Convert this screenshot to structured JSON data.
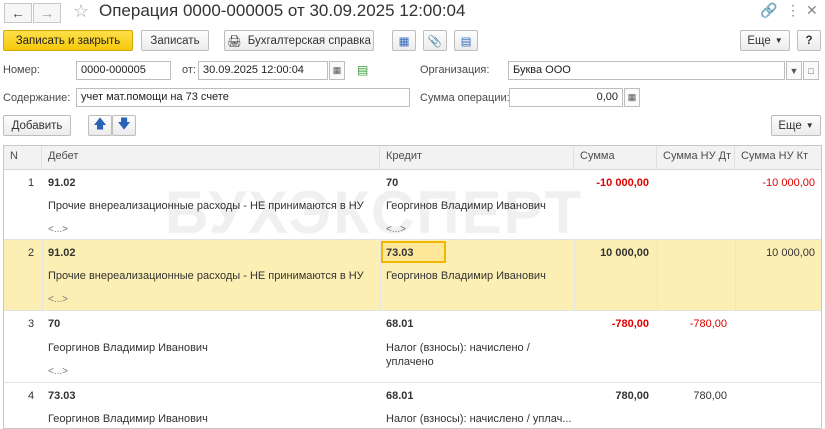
{
  "window": {
    "title": "Операция 0000-000005 от 30.09.2025 12:00:04"
  },
  "toolbar": {
    "save_close": "Записать и закрыть",
    "save": "Записать",
    "accounting_report": "Бухгалтерская справка",
    "more": "Еще"
  },
  "form": {
    "number_label": "Номер:",
    "number_value": "0000-000005",
    "date_label": "от:",
    "date_value": "30.09.2025 12:00:04",
    "org_label": "Организация:",
    "org_value": "Буква ООО",
    "content_label": "Содержание:",
    "content_value": "учет мат.помощи на 73 счете",
    "sum_label": "Сумма операции:",
    "sum_value": "0,00"
  },
  "table_toolbar": {
    "add": "Добавить",
    "more": "Еще"
  },
  "table": {
    "headers": {
      "n": "N",
      "debit": "Дебет",
      "credit": "Кредит",
      "sum": "Сумма",
      "sum_nu_dt": "Сумма НУ Дт",
      "sum_nu_kt": "Сумма НУ Кт"
    },
    "rows": [
      {
        "n": "1",
        "debit_account": "91.02",
        "debit_sub1": "Прочие внереализационные расходы - НЕ принимаются в НУ",
        "debit_sub2": "<...>",
        "credit_account": "70",
        "credit_sub1": "Георгинов Владимир Иванович",
        "credit_sub2": "<...>",
        "sum": "-10 000,00",
        "sum_nu_dt": "",
        "sum_nu_kt": "-10 000,00"
      },
      {
        "n": "2",
        "debit_account": "91.02",
        "debit_sub1": "Прочие внереализационные расходы - НЕ принимаются в НУ",
        "debit_sub2": "<...>",
        "credit_account": "73.03",
        "credit_sub1": "Георгинов Владимир Иванович",
        "credit_sub2": "",
        "sum": "10 000,00",
        "sum_nu_dt": "",
        "sum_nu_kt": "10 000,00"
      },
      {
        "n": "3",
        "debit_account": "70",
        "debit_sub1": "Георгинов Владимир Иванович",
        "debit_sub2": "<...>",
        "credit_account": "68.01",
        "credit_sub1": "Налог (взносы): начислено /",
        "credit_sub1b": "уплачено",
        "sum": "-780,00",
        "sum_nu_dt": "-780,00",
        "sum_nu_kt": ""
      },
      {
        "n": "4",
        "debit_account": "73.03",
        "debit_sub1": "Георгинов Владимир Иванович",
        "credit_account": "68.01",
        "credit_sub1": "Налог (взносы): начислено / уплач...",
        "sum": "780,00",
        "sum_nu_dt": "780,00",
        "sum_nu_kt": ""
      }
    ]
  },
  "watermark": "БУХЭКСПЕРТ"
}
